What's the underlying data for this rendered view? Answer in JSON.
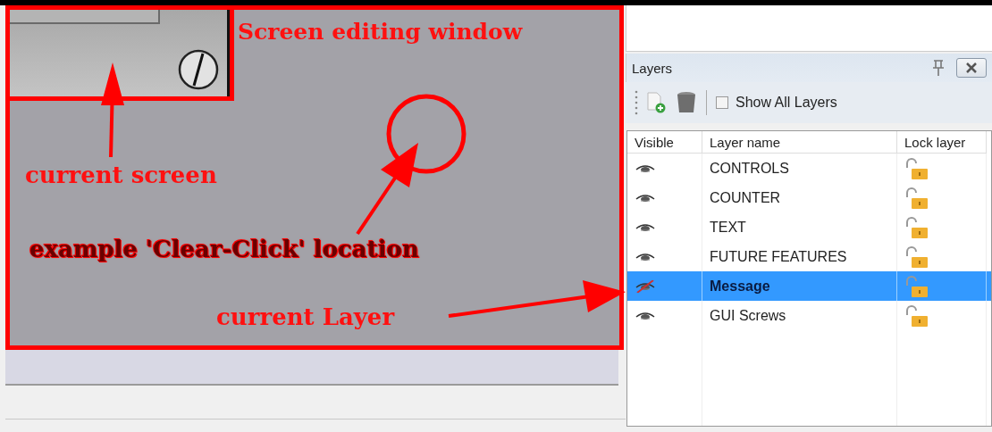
{
  "editor": {
    "annotations": [
      {
        "kind": "title",
        "text": "Screen editing window"
      },
      {
        "kind": "callout",
        "text": "current screen"
      },
      {
        "kind": "dark",
        "text": "example 'Clear-Click' location"
      },
      {
        "kind": "callout",
        "text": "current Layer"
      }
    ]
  },
  "layers_panel": {
    "title": "Layers",
    "show_all_layers": {
      "label": "Show All Layers",
      "checked": false
    },
    "columns": [
      "Visible",
      "Layer name",
      "Lock layer"
    ],
    "rows": [
      {
        "name": "CONTROLS",
        "visible": true,
        "locked": false,
        "selected": false
      },
      {
        "name": "COUNTER",
        "visible": true,
        "locked": false,
        "selected": false
      },
      {
        "name": "TEXT",
        "visible": true,
        "locked": false,
        "selected": false
      },
      {
        "name": "FUTURE FEATURES",
        "visible": true,
        "locked": false,
        "selected": false
      },
      {
        "name": "Message",
        "visible": false,
        "locked": false,
        "selected": true
      },
      {
        "name": "GUI Screws",
        "visible": true,
        "locked": false,
        "selected": false
      }
    ]
  }
}
